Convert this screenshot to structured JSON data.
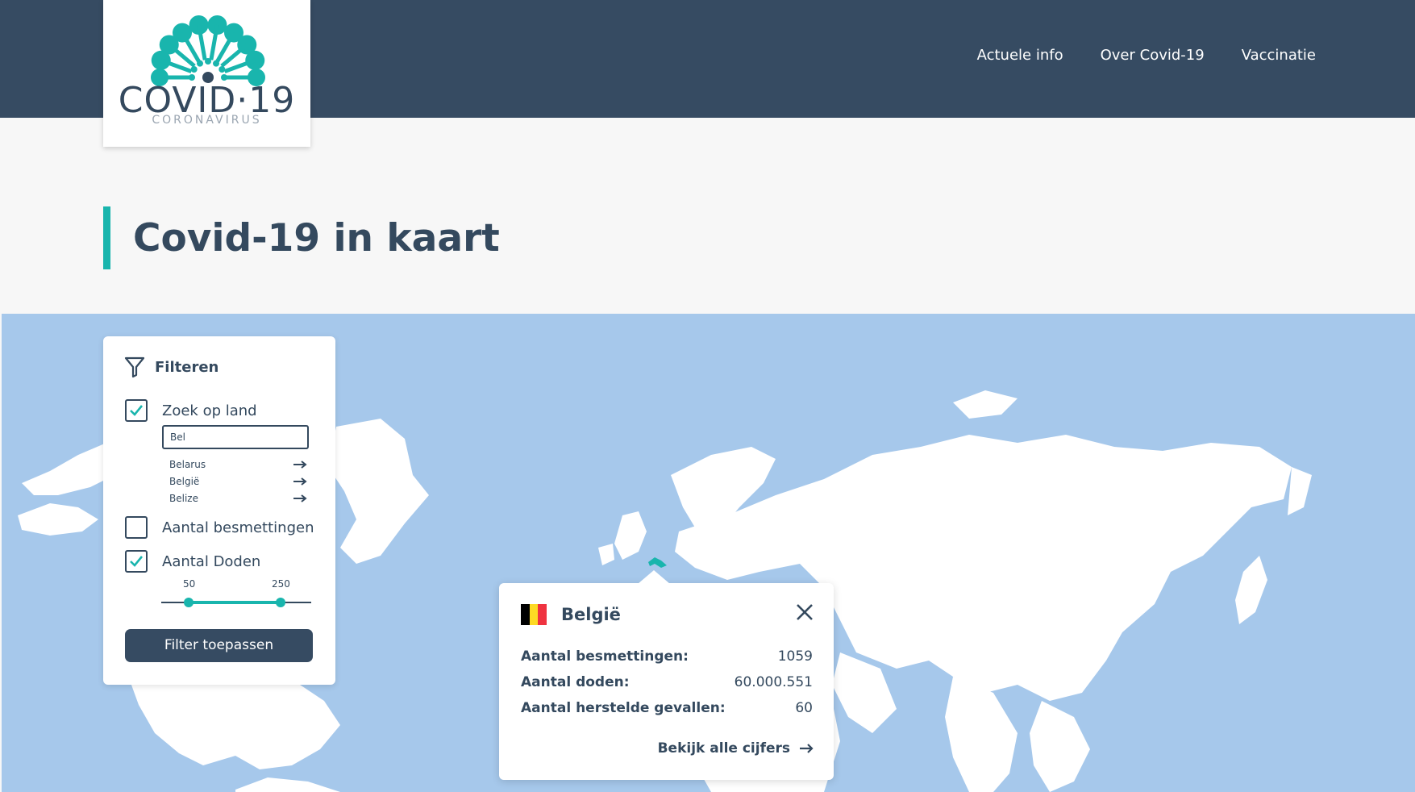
{
  "header": {
    "logo": {
      "main_text": "COVID·19",
      "sub_text": "CORONAVIRUS",
      "icon": "virus-logo-icon"
    },
    "nav": [
      {
        "label": "Actuele info"
      },
      {
        "label": "Over Covid-19"
      },
      {
        "label": "Vaccinatie"
      }
    ]
  },
  "page": {
    "title": "Covid-19 in kaart"
  },
  "filter": {
    "heading": "Filteren",
    "icon": "filter-icon",
    "search_country": {
      "label": "Zoek op land",
      "checked": true,
      "value": "Bel"
    },
    "suggestions": [
      {
        "label": "Belarus"
      },
      {
        "label": "België"
      },
      {
        "label": "Belize"
      }
    ],
    "infections": {
      "label": "Aantal besmettingen",
      "checked": false
    },
    "deaths": {
      "label": "Aantal Doden",
      "checked": true
    },
    "slider": {
      "min_label": "50",
      "max_label": "250",
      "low": 50,
      "high": 250
    },
    "apply_label": "Filter toepassen"
  },
  "popup": {
    "country": "België",
    "flag_colors": [
      "#000000",
      "#fdda24",
      "#ef3340"
    ],
    "stats": [
      {
        "label": "Aantal besmettingen:",
        "value": "1059"
      },
      {
        "label": "Aantal doden:",
        "value": "60.000.551"
      },
      {
        "label": "Aantal herstelde gevallen:",
        "value": "60"
      }
    ],
    "link_label": "Bekijk alle cijfers"
  },
  "colors": {
    "header_bg": "#364b62",
    "accent": "#19b5ad",
    "map_water": "#a6c8eb",
    "land": "#ffffff"
  }
}
